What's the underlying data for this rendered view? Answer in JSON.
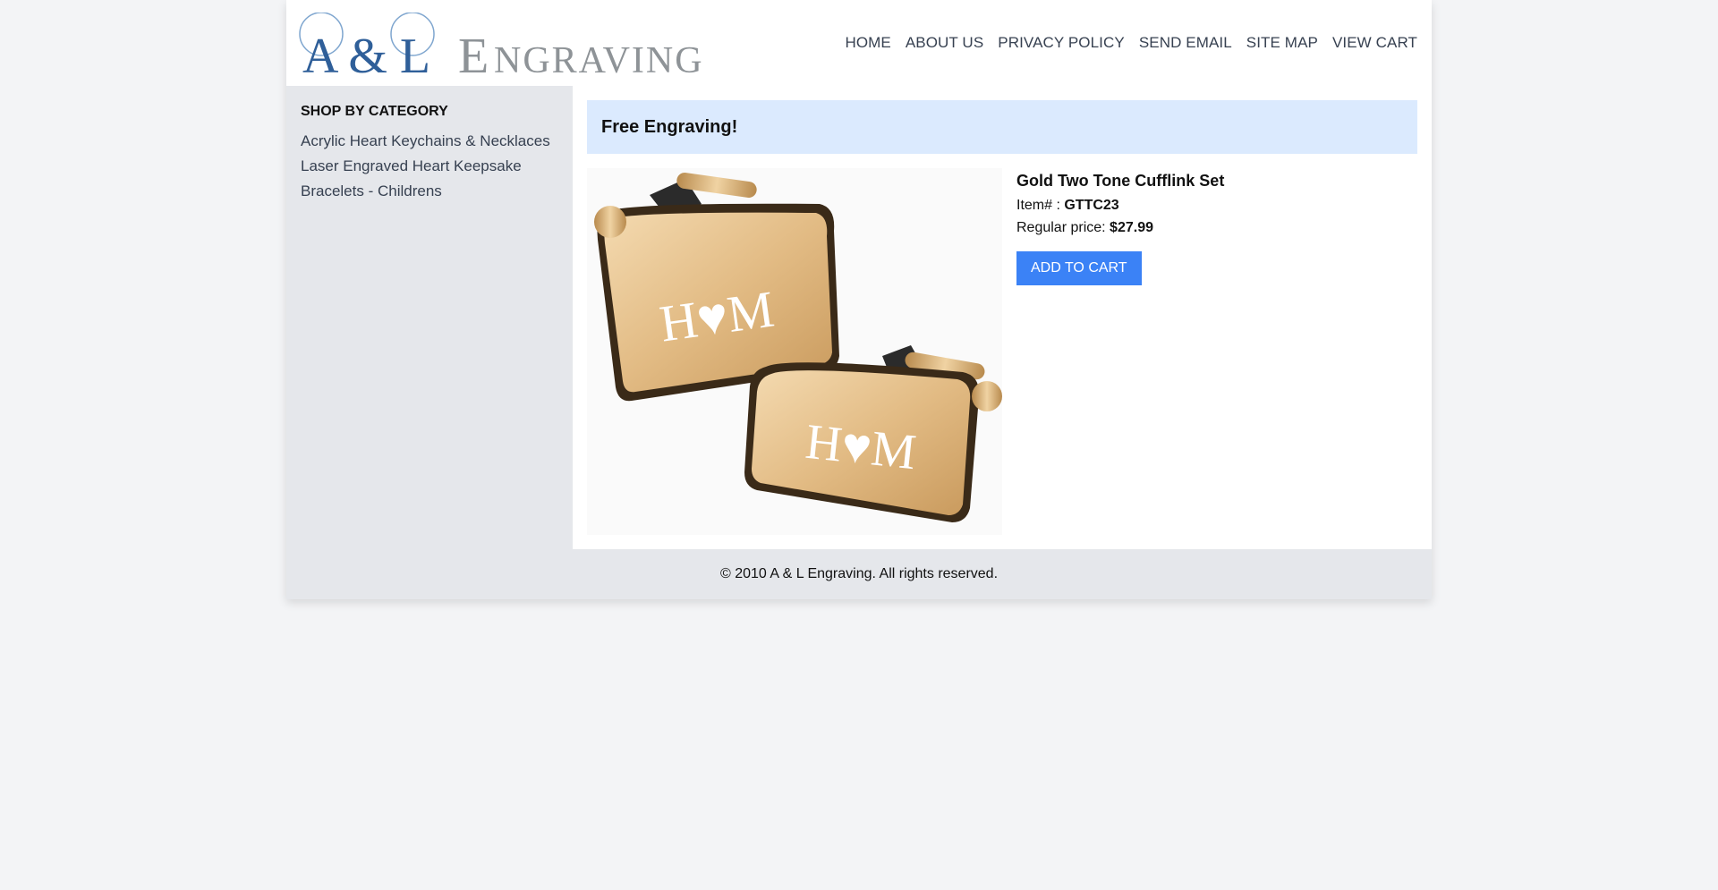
{
  "header": {
    "logo_text": "A & L Engraving",
    "nav": [
      "HOME",
      "ABOUT US",
      "PRIVACY POLICY",
      "SEND EMAIL",
      "SITE MAP",
      "VIEW CART"
    ]
  },
  "sidebar": {
    "title": "SHOP BY CATEGORY",
    "items": [
      "Acrylic Heart Keychains & Necklaces",
      "Laser Engraved Heart Keepsake",
      "Bracelets - Childrens"
    ]
  },
  "main": {
    "banner": "Free Engraving!",
    "product": {
      "name": "Gold Two Tone Cufflink Set",
      "item_label": "Item# : ",
      "item_number": "GTTC23",
      "price_label": "Regular price: ",
      "price": "$27.99",
      "engraving": "H♥M",
      "add_to_cart": "ADD TO CART"
    }
  },
  "footer": {
    "copyright": "© 2010 A & L Engraving. All rights reserved."
  },
  "colors": {
    "accent": "#3b82f6",
    "banner_bg": "#dbeafe",
    "logo_blue": "#2f5f99",
    "logo_gray": "#8e9397",
    "gold": "#d9b27a"
  }
}
